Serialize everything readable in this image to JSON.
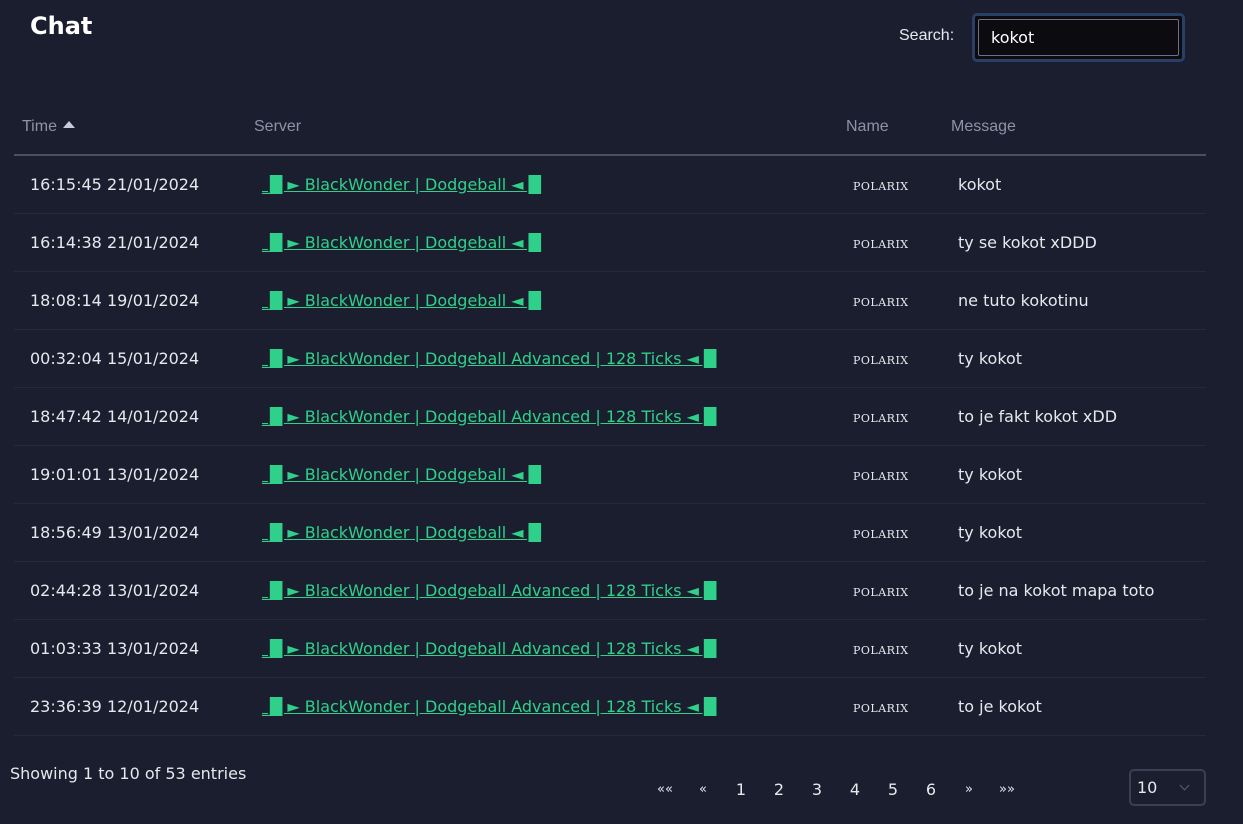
{
  "header": {
    "title": "Chat"
  },
  "search": {
    "label": "Search:",
    "value": "kokot"
  },
  "table": {
    "columns": [
      "Time",
      "Server",
      "Name",
      "Message"
    ],
    "sort": {
      "column": "Time",
      "direction": "asc"
    },
    "rows": [
      {
        "time": "16:15:45 21/01/2024",
        "server": "_█ ► BlackWonder | Dodgeball ◄ █",
        "name": "POLARIX",
        "message": "kokot"
      },
      {
        "time": "16:14:38 21/01/2024",
        "server": "_█ ► BlackWonder | Dodgeball ◄ █",
        "name": "POLARIX",
        "message": "ty se kokot xDDD"
      },
      {
        "time": "18:08:14 19/01/2024",
        "server": "_█ ► BlackWonder | Dodgeball ◄ █",
        "name": "POLARIX",
        "message": "ne tuto kokotinu"
      },
      {
        "time": "00:32:04 15/01/2024",
        "server": "_█ ► BlackWonder | Dodgeball Advanced | 128 Ticks ◄ █",
        "name": "POLARIX",
        "message": "ty kokot"
      },
      {
        "time": "18:47:42 14/01/2024",
        "server": "_█ ► BlackWonder | Dodgeball Advanced | 128 Ticks ◄ █",
        "name": "POLARIX",
        "message": "to je fakt kokot xDD"
      },
      {
        "time": "19:01:01 13/01/2024",
        "server": "_█ ► BlackWonder | Dodgeball ◄ █",
        "name": "POLARIX",
        "message": "ty kokot"
      },
      {
        "time": "18:56:49 13/01/2024",
        "server": "_█ ► BlackWonder | Dodgeball ◄ █",
        "name": "POLARIX",
        "message": "ty kokot"
      },
      {
        "time": "02:44:28 13/01/2024",
        "server": "_█ ► BlackWonder | Dodgeball Advanced | 128 Ticks ◄ █",
        "name": "POLARIX",
        "message": "to je na kokot mapa toto"
      },
      {
        "time": "01:03:33 13/01/2024",
        "server": "_█ ► BlackWonder | Dodgeball Advanced | 128 Ticks ◄ █",
        "name": "POLARIX",
        "message": "ty kokot"
      },
      {
        "time": "23:36:39 12/01/2024",
        "server": "_█ ► BlackWonder | Dodgeball Advanced | 128 Ticks ◄ █",
        "name": "POLARIX",
        "message": "to je kokot"
      }
    ]
  },
  "info": "Showing 1 to 10 of 53 entries",
  "pagination": {
    "first": "««",
    "prev": "«",
    "pages": [
      "1",
      "2",
      "3",
      "4",
      "5",
      "6"
    ],
    "next": "»",
    "last": "»»"
  },
  "page_length": {
    "value": "10"
  },
  "colors": {
    "background": "#1b1e2e",
    "link": "#2fd08a",
    "search_border": "#2a3f66"
  }
}
